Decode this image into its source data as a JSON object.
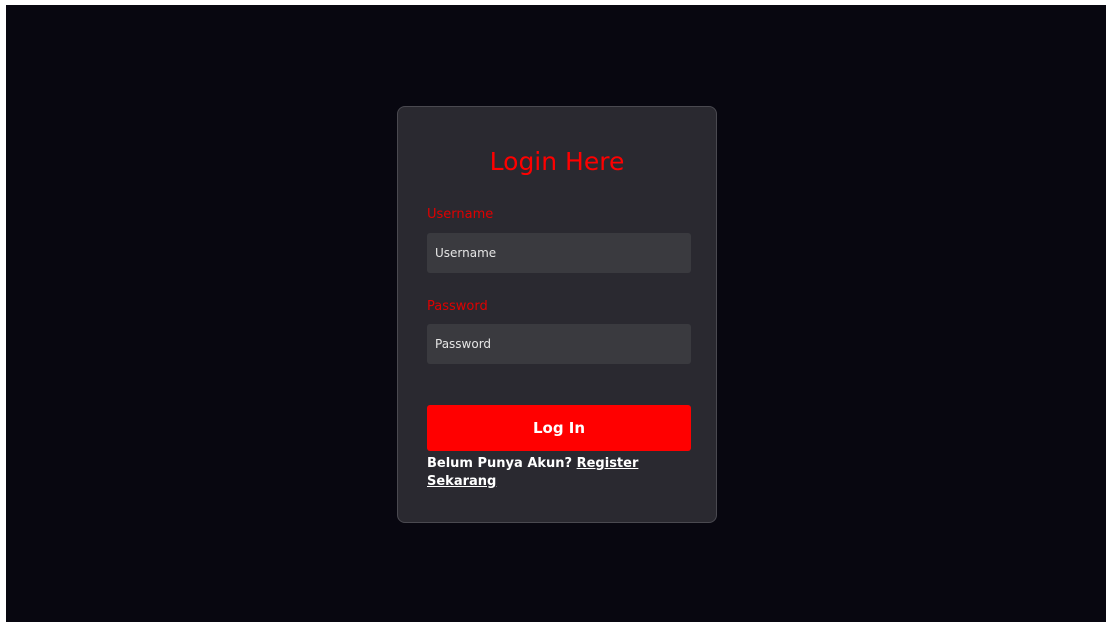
{
  "colors": {
    "page_background": "#080710",
    "card_background": "#2a2930",
    "input_background": "#3a3a3f",
    "accent": "#ff0000",
    "label_color": "#e00000",
    "text_white": "#ffffff"
  },
  "login_form": {
    "title": "Login Here",
    "username_label": "Username",
    "username_placeholder": "Username",
    "username_value": "",
    "password_label": "Password",
    "password_placeholder": "Password",
    "password_value": "",
    "submit_label": "Log In",
    "register_prompt": "Belum Punya Akun?",
    "register_link": "Register Sekarang"
  }
}
